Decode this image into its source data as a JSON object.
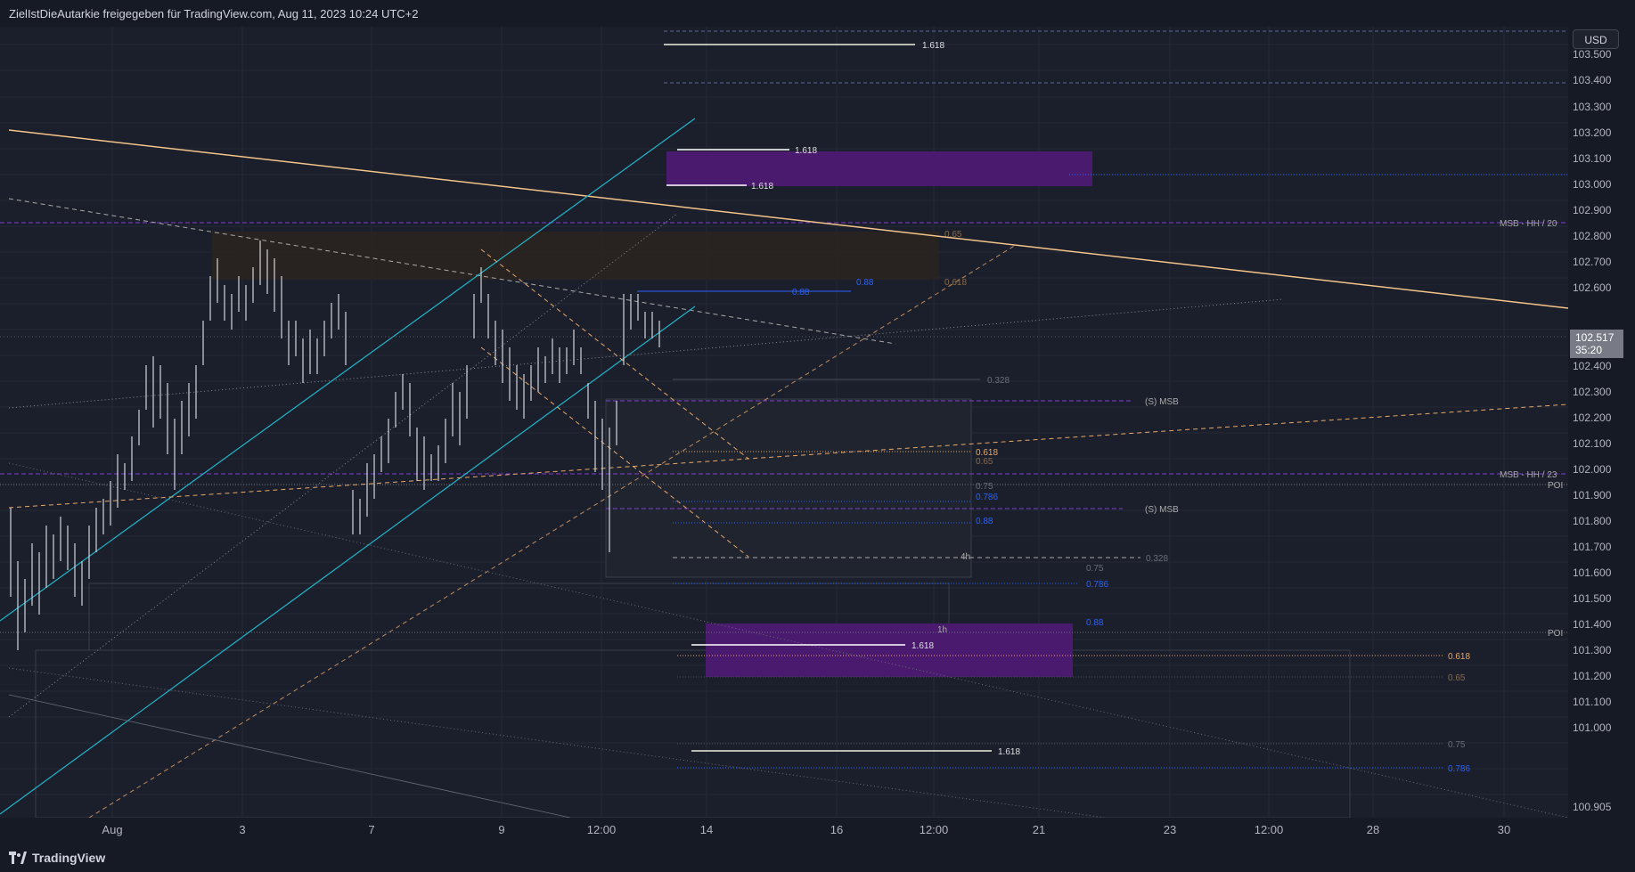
{
  "header": {
    "title": "ZielIstDieAutarkie freigegeben für TradingView.com, Aug 11, 2023 10:24 UTC+2"
  },
  "currency_button": "USD",
  "current_price": {
    "value": "102.517",
    "countdown": "35:20"
  },
  "price_axis": {
    "ticks": [
      "103.500",
      "103.400",
      "103.300",
      "103.200",
      "103.100",
      "103.000",
      "102.900",
      "102.800",
      "102.700",
      "102.600",
      "102.400",
      "102.300",
      "102.200",
      "102.100",
      "102.000",
      "101.900",
      "101.800",
      "101.700",
      "101.600",
      "101.500",
      "101.400",
      "101.300",
      "101.200",
      "101.100",
      "101.000",
      "100.905"
    ]
  },
  "time_axis": {
    "ticks": [
      "Aug",
      "3",
      "7",
      "9",
      "12:00",
      "14",
      "16",
      "12:00",
      "21",
      "23",
      "12:00",
      "28",
      "30"
    ]
  },
  "annotations": {
    "fib_1618_a": "1.618",
    "fib_1618_b": "1.618",
    "fib_1618_c": "1.618",
    "fib_1618_d": "1.618",
    "fib_1618_e": "1.618",
    "fib_088_a": "0.88",
    "fib_088_b": "0.88",
    "fib_065_top": "0.65",
    "fib_0618_top": "0.618",
    "fib_0328_a": "0.328",
    "smsb_a": "(S) MSB",
    "smsb_b": "(S) MSB",
    "msb_hh20": "MSB - HH / 20",
    "msb_hh23": "MSB - HH / 23",
    "poi_a": "POI",
    "poi_b": "POI",
    "fib_0618_mid": "0.618",
    "fib_065_mid": "0.65",
    "fib_075_mid": "0.75",
    "fib_0786_mid": "0.786",
    "fib_088_mid": "0.88",
    "label_4h": "4h",
    "fib_0328_b": "0.328",
    "fib_075_low": "0.75",
    "fib_0786_low": "0.786",
    "fib_088_low": "0.88",
    "label_1h": "1h",
    "fib_0618_right": "0.618",
    "fib_065_right": "0.65",
    "fib_075_right": "0.75",
    "fib_0786_right": "0.786"
  },
  "footer": {
    "brand": "TradingView"
  },
  "colors": {
    "background": "#1b1f2b",
    "candle": "#d1d4dc",
    "purple_zone": "#4a1a6e",
    "cyan": "#22b5c9",
    "orange": "#e8b87a",
    "fib_blue": "#2962ff",
    "msb_purple": "#7b3fc4"
  }
}
